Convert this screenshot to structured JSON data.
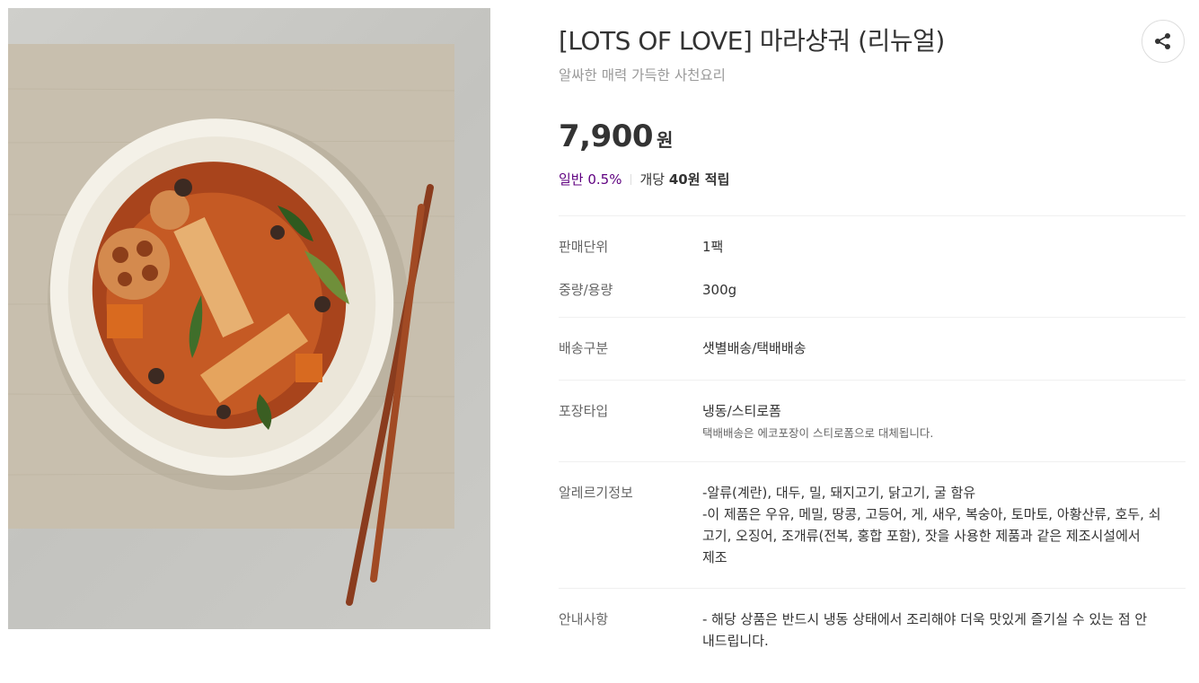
{
  "product": {
    "title": "[LOTS OF LOVE] 마라샹궈 (리뉴얼)",
    "subtitle": "알싸한 매력 가득한 사천요리",
    "image_alt_icon": "food-photo"
  },
  "price": {
    "amount": "7,900",
    "unit": "원"
  },
  "points": {
    "grade": "일반 0.5%",
    "per_label": "개당",
    "amount": "40원 적립"
  },
  "share": {
    "icon": "share-icon"
  },
  "details": [
    {
      "label": "판매단위",
      "value": "1팩"
    },
    {
      "label": "중량/용량",
      "value": "300g"
    },
    {
      "label": "배송구분",
      "value": "샛별배송/택배배송"
    },
    {
      "label": "포장타입",
      "value": "냉동/스티로폼",
      "note": "택배배송은 에코포장이 스티로폼으로 대체됩니다."
    },
    {
      "label": "알레르기정보",
      "lines": [
        "-알류(계란), 대두, 밀, 돼지고기, 닭고기, 굴 함유",
        "-이 제품은 우유, 메밀, 땅콩, 고등어, 게, 새우, 복숭아, 토마토, 아황산류, 호두, 쇠",
        "고기, 오징어, 조개류(전복, 홍합 포함), 잣을 사용한 제품과 같은 제조시설에서",
        "제조"
      ]
    },
    {
      "label": "안내사항",
      "lines": [
        "- 해당 상품은 반드시 냉동 상태에서 조리해야 더욱 맛있게 즐기실 수 있는 점 안",
        "내드립니다."
      ]
    }
  ],
  "colors": {
    "accent": "#5f0080",
    "label": "#666666",
    "text": "#333333",
    "muted": "#999999"
  }
}
